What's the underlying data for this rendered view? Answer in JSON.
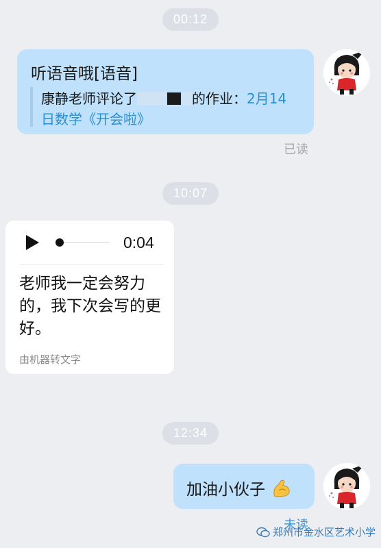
{
  "timestamps": [
    "00:12",
    "10:07",
    "12:34"
  ],
  "message1": {
    "line1": "听语音哦[语音]",
    "quote_start": "康静老师评论了",
    "quote_mid": "的作业：",
    "quote_highlight_a": "2月14",
    "quote_highlight_b": "日数学《开会啦》",
    "status": "已读"
  },
  "voice_message": {
    "duration": "0:04",
    "transcript": "老师我一定会努力的，我下次会写的更好。",
    "machine_label": "由机器转文字"
  },
  "message2": {
    "text": "加油小伙子",
    "emoji": "flexed-biceps-icon",
    "status": "未读"
  },
  "watermark": {
    "text": "郑州市金水区艺术小学"
  },
  "colors": {
    "background": "#eceef2",
    "my_bubble": "#bfe1fb",
    "link_blue": "#2a8fd6",
    "read_gray": "#a3a6ab"
  }
}
